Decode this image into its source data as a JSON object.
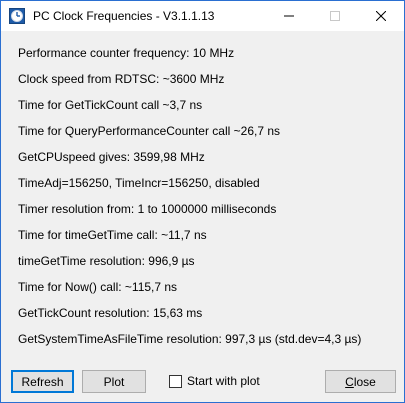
{
  "window": {
    "title": "PC Clock Frequencies - V3.1.1.13"
  },
  "info": {
    "lines": [
      "Performance counter frequency: 10 MHz",
      "Clock speed from RDTSC: ~3600 MHz",
      "Time for GetTickCount call ~3,7 ns",
      "Time for QueryPerformanceCounter call ~26,7 ns",
      "GetCPUspeed gives: 3599,98 MHz",
      "TimeAdj=156250, TimeIncr=156250, disabled",
      "Timer resolution from: 1 to 1000000 milliseconds",
      "Time for timeGetTime call: ~11,7 ns",
      "timeGetTime resolution: 996,9 µs",
      "Time for Now() call: ~115,7 ns",
      "GetTickCount resolution: 15,63 ms",
      "GetSystemTimeAsFileTime resolution: 997,3 µs  (std.dev=4,3 µs)"
    ]
  },
  "buttons": {
    "refresh": "Refresh",
    "plot": "Plot",
    "close_mnemonic": "C",
    "close_rest": "lose"
  },
  "options": {
    "start_with_plot": {
      "label": "Start with plot",
      "checked": false
    }
  },
  "icons": {
    "app": "clock-icon",
    "minimize": "minimize-icon",
    "maximize": "maximize-icon",
    "close": "close-icon"
  },
  "colors": {
    "window_border": "#2a6fd1",
    "client_background": "#f0f0f0",
    "default_button_border": "#0078d7",
    "button_face": "#e1e1e1"
  }
}
